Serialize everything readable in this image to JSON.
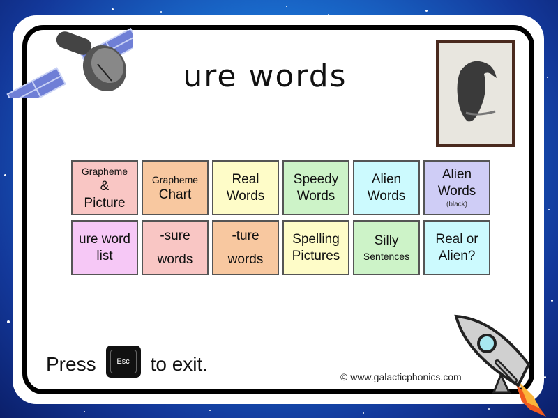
{
  "page": {
    "title": "ure words",
    "accent_colors": {
      "background_space": "#1a6fd0",
      "frame_border": "#000000"
    }
  },
  "tiles": [
    {
      "lines": [
        "Grapheme",
        "&",
        "Picture"
      ],
      "color": "#f9c6c4"
    },
    {
      "lines": [
        "Grapheme",
        "Chart"
      ],
      "color": "#f8c8a0"
    },
    {
      "lines": [
        "Real",
        "Words"
      ],
      "color": "#fefcc8"
    },
    {
      "lines": [
        "Speedy",
        "Words"
      ],
      "color": "#cdf3c8"
    },
    {
      "lines": [
        "Alien",
        "Words"
      ],
      "color": "#ccfafe"
    },
    {
      "lines": [
        "Alien",
        "Words",
        "(black)"
      ],
      "color": "#cfcdf6"
    },
    {
      "lines": [
        "ure word",
        "list"
      ],
      "color": "#f6c8f6"
    },
    {
      "lines": [
        "-sure",
        "words"
      ],
      "color": "#f9c6c4"
    },
    {
      "lines": [
        "-ture",
        "words"
      ],
      "color": "#f8c8a0"
    },
    {
      "lines": [
        "Spelling",
        "Pictures"
      ],
      "color": "#fefcc8"
    },
    {
      "lines": [
        "Silly",
        "Sentences"
      ],
      "color": "#cdf3c8"
    },
    {
      "lines": [
        "Real or",
        "Alien?"
      ],
      "color": "#ccfafe"
    }
  ],
  "footer": {
    "press_label": "Press",
    "esc_key_label": "Esc",
    "exit_label": "to exit.",
    "copyright": "© www.galacticphonics.com"
  },
  "decor": {
    "satellite_icon": "satellite-icon",
    "rocket_icon": "rocket-icon",
    "picture": "vulture-picture"
  }
}
